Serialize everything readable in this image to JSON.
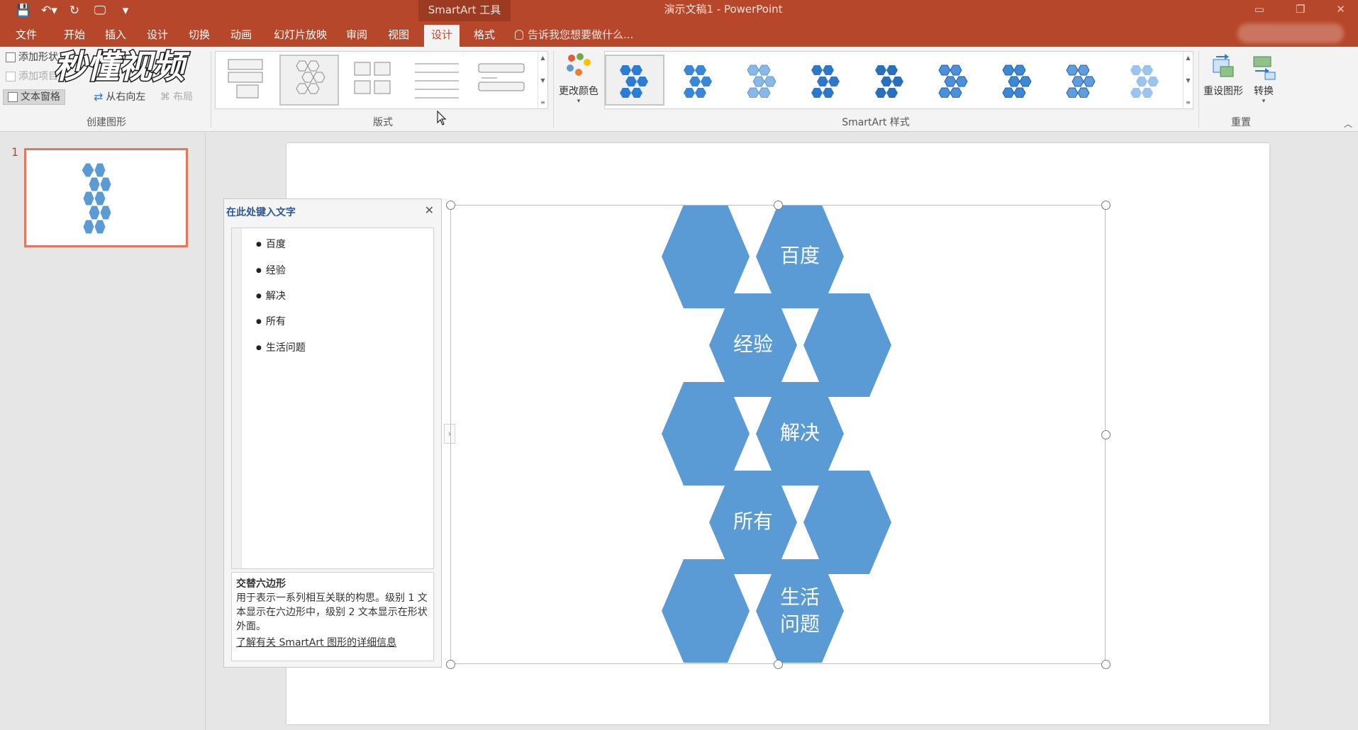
{
  "app": {
    "contextual_tab": "SmartArt 工具",
    "doc_title": "演示文稿1 - PowerPoint",
    "window_controls": [
      "▭",
      "❐",
      "✕"
    ]
  },
  "qat": [
    "💾",
    "↶▾",
    "↻",
    "🖵",
    "▾"
  ],
  "tabs": [
    {
      "label": "文件"
    },
    {
      "label": "开始"
    },
    {
      "label": "插入"
    },
    {
      "label": "设计"
    },
    {
      "label": "切换"
    },
    {
      "label": "动画"
    },
    {
      "label": "幻灯片放映"
    },
    {
      "label": "审阅"
    },
    {
      "label": "视图"
    },
    {
      "label": "设计",
      "active": true
    },
    {
      "label": "格式"
    }
  ],
  "tell_me": "告诉我您想要做什么...",
  "ribbon": {
    "create_graphic": {
      "add_shape": "添加形状",
      "add_bullet": "添加项目",
      "text_pane": "文本窗格",
      "right_to_left": "从右向左",
      "layout": "布局",
      "label": "创建图形"
    },
    "layouts": {
      "label": "版式"
    },
    "change_colors": "更改颜色",
    "styles": {
      "label": "SmartArt 样式"
    },
    "reset_graphic": "重设图形",
    "convert": "转换",
    "reset_label": "重置"
  },
  "watermark": "秒懂视频",
  "slide_number": "1",
  "text_pane": {
    "title": "在此处键入文字",
    "close": "✕",
    "items": [
      "百度",
      "经验",
      "解决",
      "所有",
      "生活问题"
    ],
    "desc_title": "交替六边形",
    "desc_body": "用于表示一系列相互关联的构思。级别 1 文本显示在六边形中，级别 2 文本显示在形状外面。",
    "desc_link": "了解有关 SmartArt 图形的详细信息",
    "expander": "›"
  },
  "smartart": {
    "hex_color": "#5b9bd5",
    "labels": [
      "百度",
      "经验",
      "解决",
      "所有",
      "生活",
      "问题"
    ]
  }
}
